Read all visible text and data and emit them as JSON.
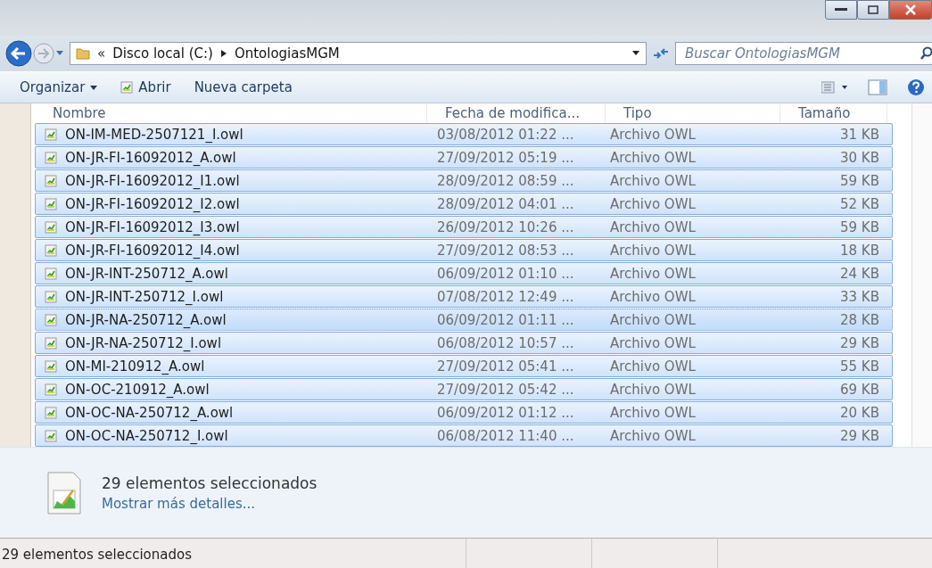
{
  "address": {
    "overflow": "«",
    "crumbs": [
      "Disco local (C:)",
      "OntologiasMGM"
    ]
  },
  "search": {
    "placeholder": "Buscar OntologiasMGM"
  },
  "toolbar": [
    "Organizar",
    "Abrir",
    "Nueva carpeta"
  ],
  "table": {
    "columns": [
      "Nombre",
      "Fecha de modifica...",
      "Tipo",
      "Tamaño"
    ],
    "rows": [
      {
        "name": "ON-IM-MED-2507121_I.owl",
        "date": "03/08/2012 01:22 ...",
        "type": "Archivo OWL",
        "size": "31 KB",
        "selected": true,
        "focused": false
      },
      {
        "name": "ON-JR-FI-16092012_A.owl",
        "date": "27/09/2012 05:19 ...",
        "type": "Archivo OWL",
        "size": "30 KB",
        "selected": true,
        "focused": false
      },
      {
        "name": "ON-JR-FI-16092012_I1.owl",
        "date": "28/09/2012 08:59 ...",
        "type": "Archivo OWL",
        "size": "59 KB",
        "selected": true,
        "focused": false
      },
      {
        "name": "ON-JR-FI-16092012_I2.owl",
        "date": "28/09/2012 04:01 ...",
        "type": "Archivo OWL",
        "size": "52 KB",
        "selected": true,
        "focused": false
      },
      {
        "name": "ON-JR-FI-16092012_I3.owl",
        "date": "26/09/2012 10:26 ...",
        "type": "Archivo OWL",
        "size": "59 KB",
        "selected": true,
        "focused": false
      },
      {
        "name": "ON-JR-FI-16092012_I4.owl",
        "date": "27/09/2012 08:53 ...",
        "type": "Archivo OWL",
        "size": "18 KB",
        "selected": true,
        "focused": false
      },
      {
        "name": "ON-JR-INT-250712_A.owl",
        "date": "06/09/2012 01:10 ...",
        "type": "Archivo OWL",
        "size": "24 KB",
        "selected": true,
        "focused": false
      },
      {
        "name": "ON-JR-INT-250712_I.owl",
        "date": "07/08/2012 12:49 ...",
        "type": "Archivo OWL",
        "size": "33 KB",
        "selected": true,
        "focused": false
      },
      {
        "name": "ON-JR-NA-250712_A.owl",
        "date": "06/09/2012 01:11 ...",
        "type": "Archivo OWL",
        "size": "28 KB",
        "selected": true,
        "focused": true
      },
      {
        "name": "ON-JR-NA-250712_I.owl",
        "date": "06/08/2012 10:57 ...",
        "type": "Archivo OWL",
        "size": "29 KB",
        "selected": true,
        "focused": false
      },
      {
        "name": "ON-MI-210912_A.owl",
        "date": "27/09/2012 05:41 ...",
        "type": "Archivo OWL",
        "size": "55 KB",
        "selected": true,
        "focused": false
      },
      {
        "name": "ON-OC-210912_A.owl",
        "date": "27/09/2012 05:42 ...",
        "type": "Archivo OWL",
        "size": "69 KB",
        "selected": true,
        "focused": false
      },
      {
        "name": "ON-OC-NA-250712_A.owl",
        "date": "06/09/2012 01:12 ...",
        "type": "Archivo OWL",
        "size": "20 KB",
        "selected": true,
        "focused": false
      },
      {
        "name": "ON-OC-NA-250712_I.owl",
        "date": "06/08/2012 11:40 ...",
        "type": "Archivo OWL",
        "size": "29 KB",
        "selected": true,
        "focused": false
      }
    ]
  },
  "details": {
    "title": "29 elementos seleccionados",
    "link": "Mostrar más detalles..."
  },
  "status_bar": "29 elementos seleccionados"
}
